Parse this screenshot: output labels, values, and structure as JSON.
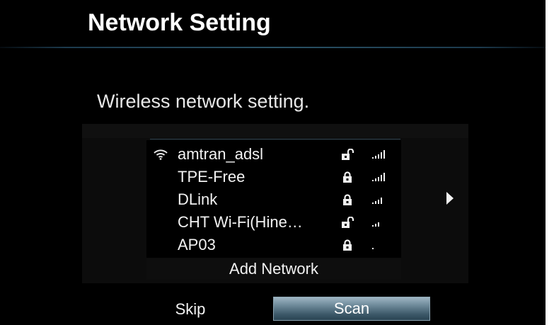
{
  "header": {
    "title": "Network Setting"
  },
  "main": {
    "subtitle": "Wireless network setting."
  },
  "network_list": {
    "items": [
      {
        "name": "amtran_adsl",
        "connected": true,
        "secured": false,
        "lock_icon": "unlocked-icon",
        "signal_bars": 5
      },
      {
        "name": "TPE-Free",
        "connected": false,
        "secured": true,
        "lock_icon": "lock-icon",
        "signal_bars": 5
      },
      {
        "name": "DLink",
        "connected": false,
        "secured": true,
        "lock_icon": "lock-icon",
        "signal_bars": 4
      },
      {
        "name": "CHT Wi-Fi(Hine…",
        "connected": false,
        "secured": false,
        "lock_icon": "unlocked-icon",
        "signal_bars": 3
      },
      {
        "name": "AP03",
        "connected": false,
        "secured": true,
        "lock_icon": "lock-icon",
        "signal_bars": 1
      }
    ],
    "add_network_label": "Add Network"
  },
  "buttons": {
    "skip_label": "Skip",
    "scan_label": "Scan"
  },
  "colors": {
    "background": "#000000",
    "text": "#f2f2f2",
    "accent": "#6e8a9a",
    "divider": "#2a5266"
  }
}
